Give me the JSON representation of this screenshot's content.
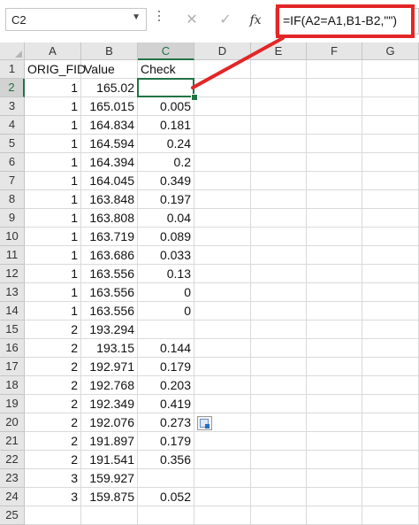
{
  "name_box": "C2",
  "formula_buttons": {
    "cancel": "✕",
    "enter": "✓",
    "fx": "fx"
  },
  "formula": "=IF(A2=A1,B1-B2,\"\")",
  "accent_color": "#217346",
  "callout_color": "#e32626",
  "active_cell": "C2",
  "columns": [
    "A",
    "B",
    "C",
    "D",
    "E",
    "F",
    "G"
  ],
  "rows": [
    {
      "n": "1",
      "a": "ORIG_FID",
      "b": "Value",
      "c": "Check"
    },
    {
      "n": "2",
      "a": "1",
      "b": "165.02",
      "c": ""
    },
    {
      "n": "3",
      "a": "1",
      "b": "165.015",
      "c": "0.005"
    },
    {
      "n": "4",
      "a": "1",
      "b": "164.834",
      "c": "0.181"
    },
    {
      "n": "5",
      "a": "1",
      "b": "164.594",
      "c": "0.24"
    },
    {
      "n": "6",
      "a": "1",
      "b": "164.394",
      "c": "0.2"
    },
    {
      "n": "7",
      "a": "1",
      "b": "164.045",
      "c": "0.349"
    },
    {
      "n": "8",
      "a": "1",
      "b": "163.848",
      "c": "0.197"
    },
    {
      "n": "9",
      "a": "1",
      "b": "163.808",
      "c": "0.04"
    },
    {
      "n": "10",
      "a": "1",
      "b": "163.719",
      "c": "0.089"
    },
    {
      "n": "11",
      "a": "1",
      "b": "163.686",
      "c": "0.033"
    },
    {
      "n": "12",
      "a": "1",
      "b": "163.556",
      "c": "0.13"
    },
    {
      "n": "13",
      "a": "1",
      "b": "163.556",
      "c": "0"
    },
    {
      "n": "14",
      "a": "1",
      "b": "163.556",
      "c": "0"
    },
    {
      "n": "15",
      "a": "2",
      "b": "193.294",
      "c": ""
    },
    {
      "n": "16",
      "a": "2",
      "b": "193.15",
      "c": "0.144"
    },
    {
      "n": "17",
      "a": "2",
      "b": "192.971",
      "c": "0.179"
    },
    {
      "n": "18",
      "a": "2",
      "b": "192.768",
      "c": "0.203"
    },
    {
      "n": "19",
      "a": "2",
      "b": "192.349",
      "c": "0.419"
    },
    {
      "n": "20",
      "a": "2",
      "b": "192.076",
      "c": "0.273"
    },
    {
      "n": "21",
      "a": "2",
      "b": "191.897",
      "c": "0.179"
    },
    {
      "n": "22",
      "a": "2",
      "b": "191.541",
      "c": "0.356"
    },
    {
      "n": "23",
      "a": "3",
      "b": "159.927",
      "c": ""
    },
    {
      "n": "24",
      "a": "3",
      "b": "159.875",
      "c": "0.052"
    },
    {
      "n": "25",
      "a": "",
      "b": "",
      "c": ""
    }
  ]
}
